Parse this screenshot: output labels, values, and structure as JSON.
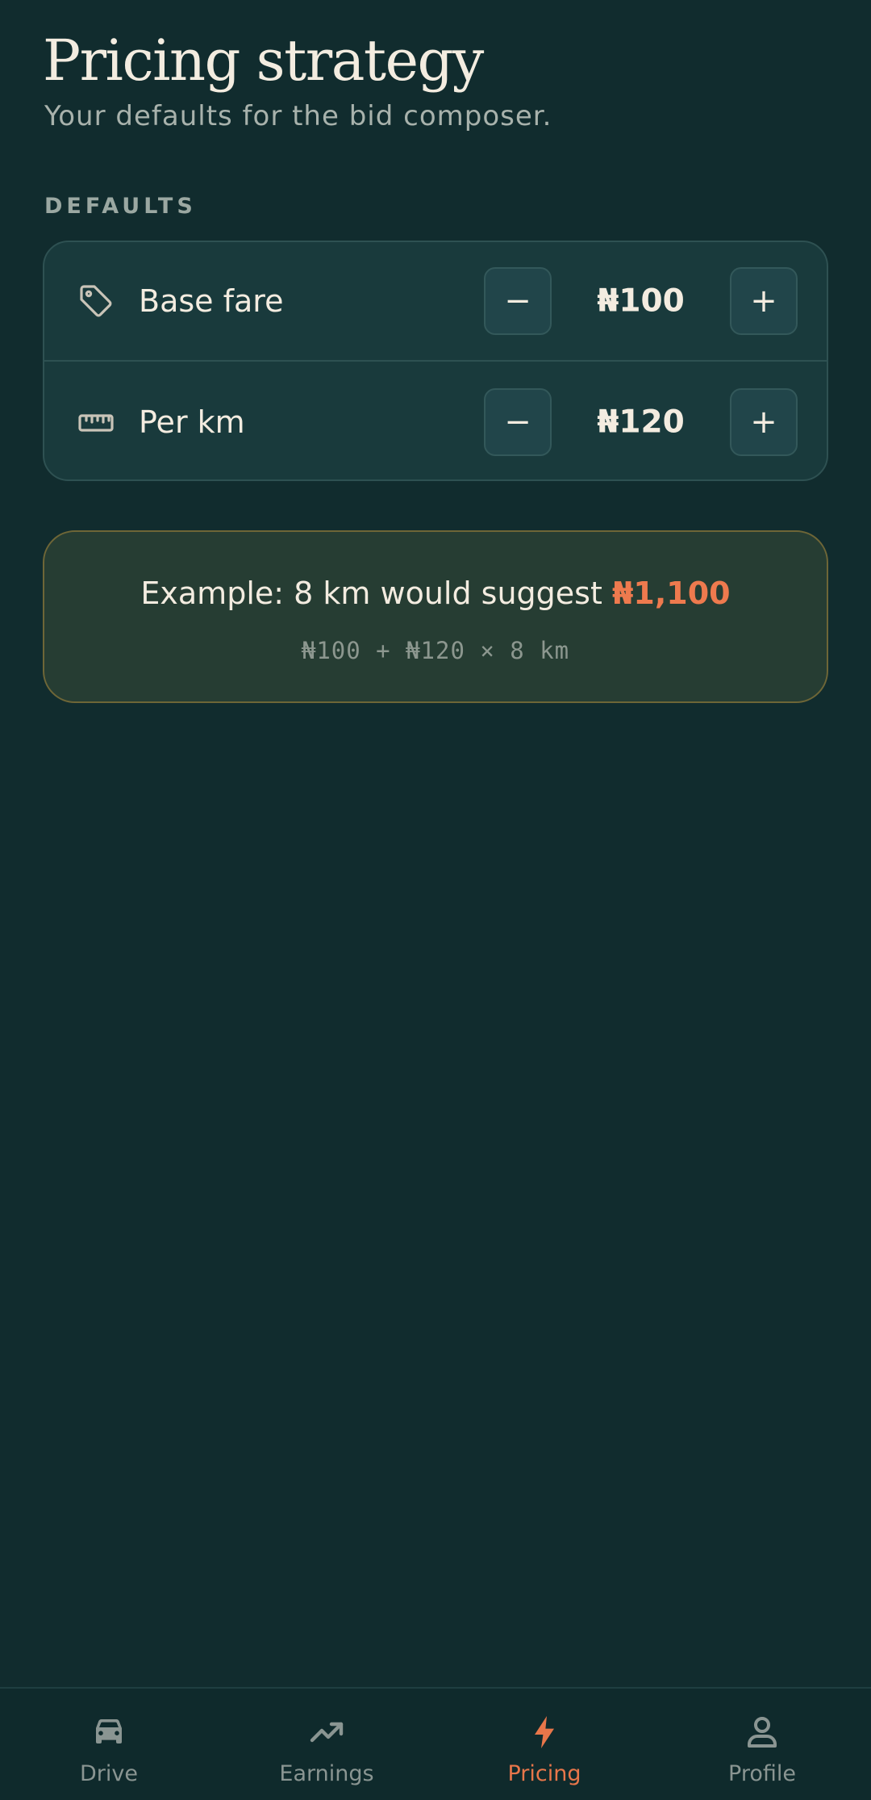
{
  "header": {
    "title": "Pricing strategy",
    "subtitle": "Your defaults for the bid composer."
  },
  "defaults": {
    "section_label": "DEFAULTS",
    "rows": [
      {
        "icon": "tag-icon",
        "label": "Base fare",
        "value": "₦100",
        "minus": "−",
        "plus": "+"
      },
      {
        "icon": "ruler-icon",
        "label": "Per km",
        "value": "₦120",
        "minus": "−",
        "plus": "+"
      }
    ]
  },
  "example": {
    "text": "Example: 8 km would suggest",
    "amount": "₦1,100",
    "formula": "₦100 + ₦120 × 8 km"
  },
  "nav": {
    "items": [
      {
        "label": "Drive",
        "icon": "car-icon",
        "active": false
      },
      {
        "label": "Earnings",
        "icon": "trending-up-icon",
        "active": false
      },
      {
        "label": "Pricing",
        "icon": "bolt-icon",
        "active": true
      },
      {
        "label": "Profile",
        "icon": "user-icon",
        "active": false
      }
    ]
  },
  "colors": {
    "background": "#112c2e",
    "accent": "#ee7a4e",
    "card": "#193a3c",
    "example_border": "#6e6637"
  }
}
